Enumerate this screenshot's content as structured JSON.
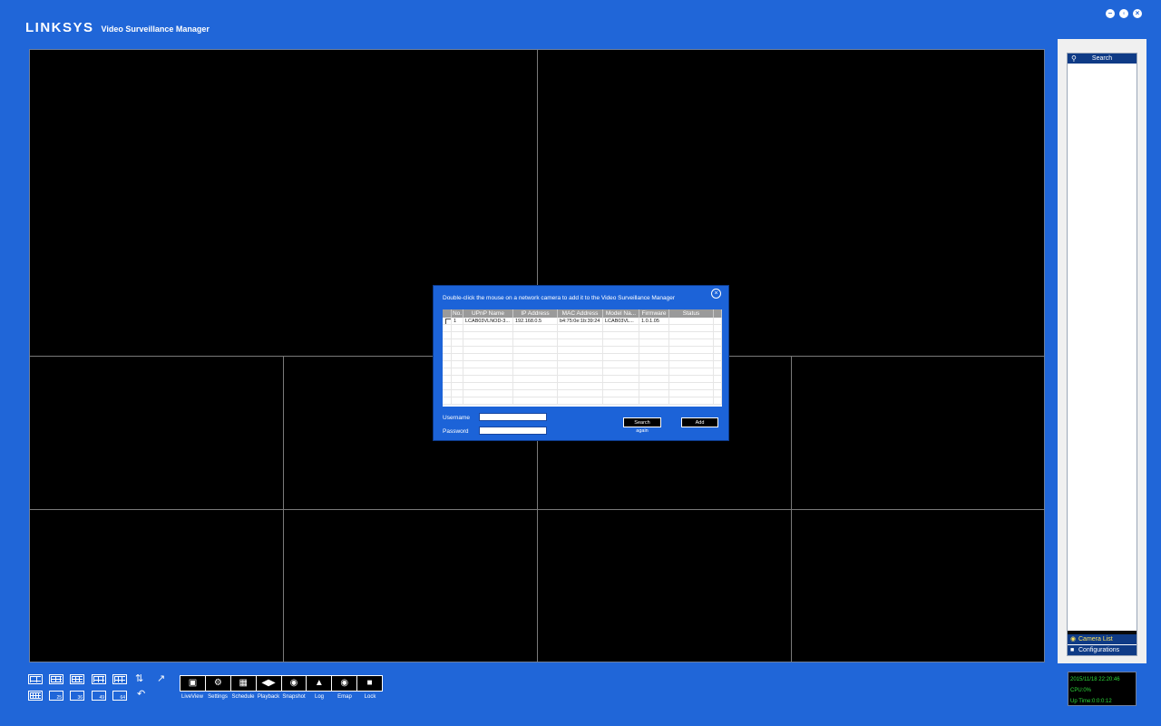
{
  "app": {
    "brand": "LINKSYS",
    "title": "Video Surveillance Manager"
  },
  "window_controls": {
    "minimize": "–",
    "restore": "◦",
    "close": "×"
  },
  "side_panel": {
    "search_tab": "Search",
    "camera_list_tab": "Camera List",
    "configurations_tab": "Configurations"
  },
  "status": {
    "datetime": "2015/11/18 22:20:46",
    "cpu": "CPU:0%",
    "uptime": "Up Time:0:0:0:12"
  },
  "layout_counts": {
    "l25": "25",
    "l36": "36",
    "l49": "49",
    "l64": "64"
  },
  "toolbar": {
    "liveview": "LiveView",
    "settings": "Settings",
    "schedule": "Schedule",
    "playback": "Playback",
    "snapshot": "Snapshot",
    "log": "Log",
    "emap": "Emap",
    "lock": "Lock"
  },
  "dialog": {
    "message": "Double-click the mouse on a network camera to add it to the Video Surveillance Manager",
    "columns": [
      "No.",
      "UPnP Name",
      "IP Address",
      "MAC Address",
      "Model Na...",
      "Firmware",
      "Status"
    ],
    "rows": [
      {
        "no": "1",
        "upnp_name": "LCAB03VLNOD-3...",
        "ip": "192.168.0.5",
        "mac": "b4:75:0e:1b:39:24",
        "model": "LCAB03VL...",
        "firmware": "1.0.1.05",
        "status": ""
      }
    ],
    "username_label": "Username",
    "password_label": "Password",
    "username_value": "",
    "password_value": "",
    "search_again": "Search again",
    "add": "Add"
  }
}
